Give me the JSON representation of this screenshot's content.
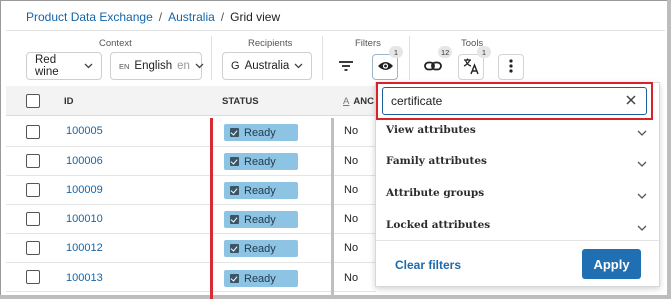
{
  "breadcrumb": {
    "items": [
      "Product Data Exchange",
      "Australia"
    ],
    "sep": "/",
    "current": "Grid view"
  },
  "toolbar": {
    "context": {
      "label": "Context",
      "channel": "Red wine",
      "lang_code": "EN",
      "language": "English",
      "language_suffix": "en"
    },
    "recipients": {
      "label": "Recipients",
      "prefix": "G",
      "value": "Australia"
    },
    "filters": {
      "label": "Filters",
      "visibility_count": "1"
    },
    "tools": {
      "label": "Tools",
      "link_count": "12",
      "translate_count": "1"
    }
  },
  "grid": {
    "columns": {
      "id": "ID",
      "status": "STATUS",
      "anc": "ANC"
    },
    "rows": [
      {
        "id": "100005",
        "status": "Ready",
        "anc": "No"
      },
      {
        "id": "100006",
        "status": "Ready",
        "anc": "No"
      },
      {
        "id": "100009",
        "status": "Ready",
        "anc": "No"
      },
      {
        "id": "100010",
        "status": "Ready",
        "anc": "No"
      },
      {
        "id": "100012",
        "status": "Ready",
        "anc": "No"
      },
      {
        "id": "100013",
        "status": "Ready",
        "anc": "No"
      }
    ]
  },
  "panel": {
    "search_value": "certificate",
    "sections": [
      "View attributes",
      "Family attributes",
      "Attribute groups",
      "Locked attributes"
    ],
    "clear_label": "Clear filters",
    "apply_label": "Apply"
  },
  "colors": {
    "link": "#1565a8",
    "status_bg": "#8ec4e3",
    "primary": "#1f6fb2",
    "highlight": "#d9202b"
  }
}
